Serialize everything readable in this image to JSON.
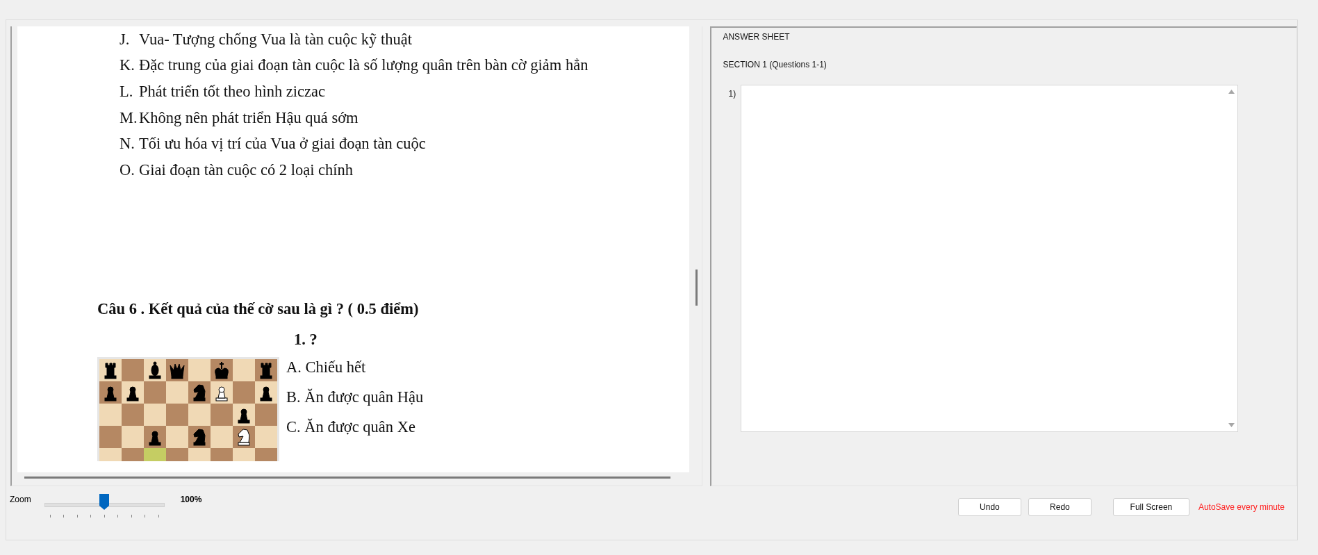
{
  "document": {
    "options": [
      {
        "letter": "J.",
        "text": "Vua- Tượng chống Vua là tàn cuộc kỹ thuật"
      },
      {
        "letter": "K.",
        "text": "Đặc trung của giai đoạn tàn cuộc là số lượng quân trên bàn cờ giảm hẳn"
      },
      {
        "letter": "L.",
        "text": "Phát triển tốt theo hình ziczac"
      },
      {
        "letter": "M.",
        "text": "Không nên phát triển Hậu quá sớm"
      },
      {
        "letter": "N.",
        "text": "Tối ưu hóa vị trí của Vua ở giai đoạn tàn cuộc"
      },
      {
        "letter": "O.",
        "text": "Giai đoạn tàn cuộc có 2 loại chính"
      }
    ],
    "question": {
      "title": "Câu 6 . Kết quả của thế cờ sau là gì ? ( 0.5 điểm)",
      "move": "1. ?",
      "choices": [
        "A. Chiếu hết",
        "B. Ăn được quân Hậu",
        "C. Ăn được quân Xe"
      ]
    }
  },
  "zoom": {
    "label": "Zoom",
    "level": 0.5,
    "reading": "100%"
  },
  "answer_sheet": {
    "title": "ANSWER SHEET",
    "section": "SECTION 1 (Questions 1-1)",
    "answers": [
      {
        "number": "1)"
      }
    ]
  },
  "buttons": [
    "Undo",
    "Redo",
    "Full Screen"
  ],
  "autosave_note": "AutoSave every minute"
}
